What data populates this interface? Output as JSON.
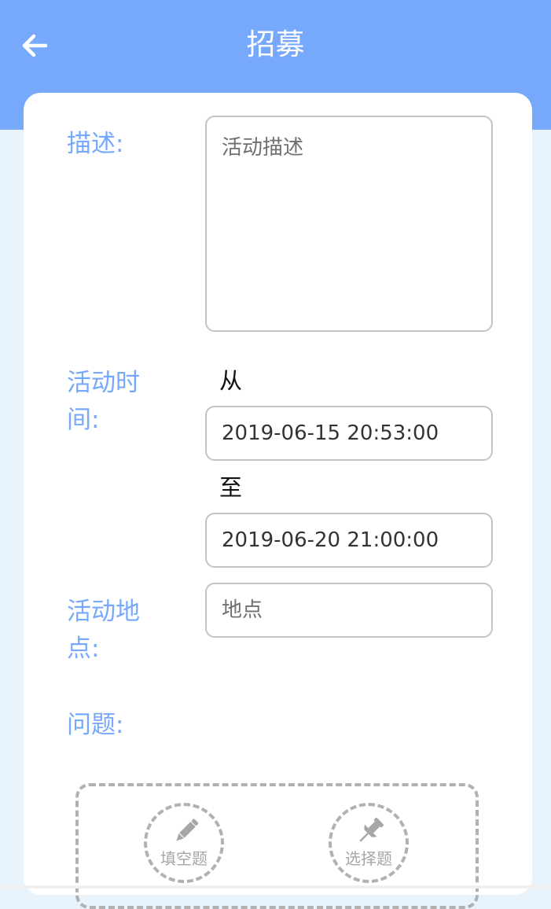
{
  "header": {
    "title": "招募",
    "back_icon": "arrow-left-icon"
  },
  "form": {
    "description": {
      "label": "描述:",
      "placeholder": "活动描述"
    },
    "time": {
      "label": "活动时间:",
      "from_label": "从",
      "from_value": "2019-06-15 20:53:00",
      "to_label": "至",
      "to_value": "2019-06-20 21:00:00"
    },
    "location": {
      "label": "活动地点:",
      "placeholder": "地点"
    },
    "questions": {
      "label": "问题:",
      "fill_blank_label": "填空题",
      "fill_blank_icon": "pencil-icon",
      "choice_label": "选择题",
      "choice_icon": "pushpin-icon"
    }
  },
  "colors": {
    "header": "#76a9fb",
    "label": "#76a9fb",
    "background": "#e9f3fc"
  }
}
